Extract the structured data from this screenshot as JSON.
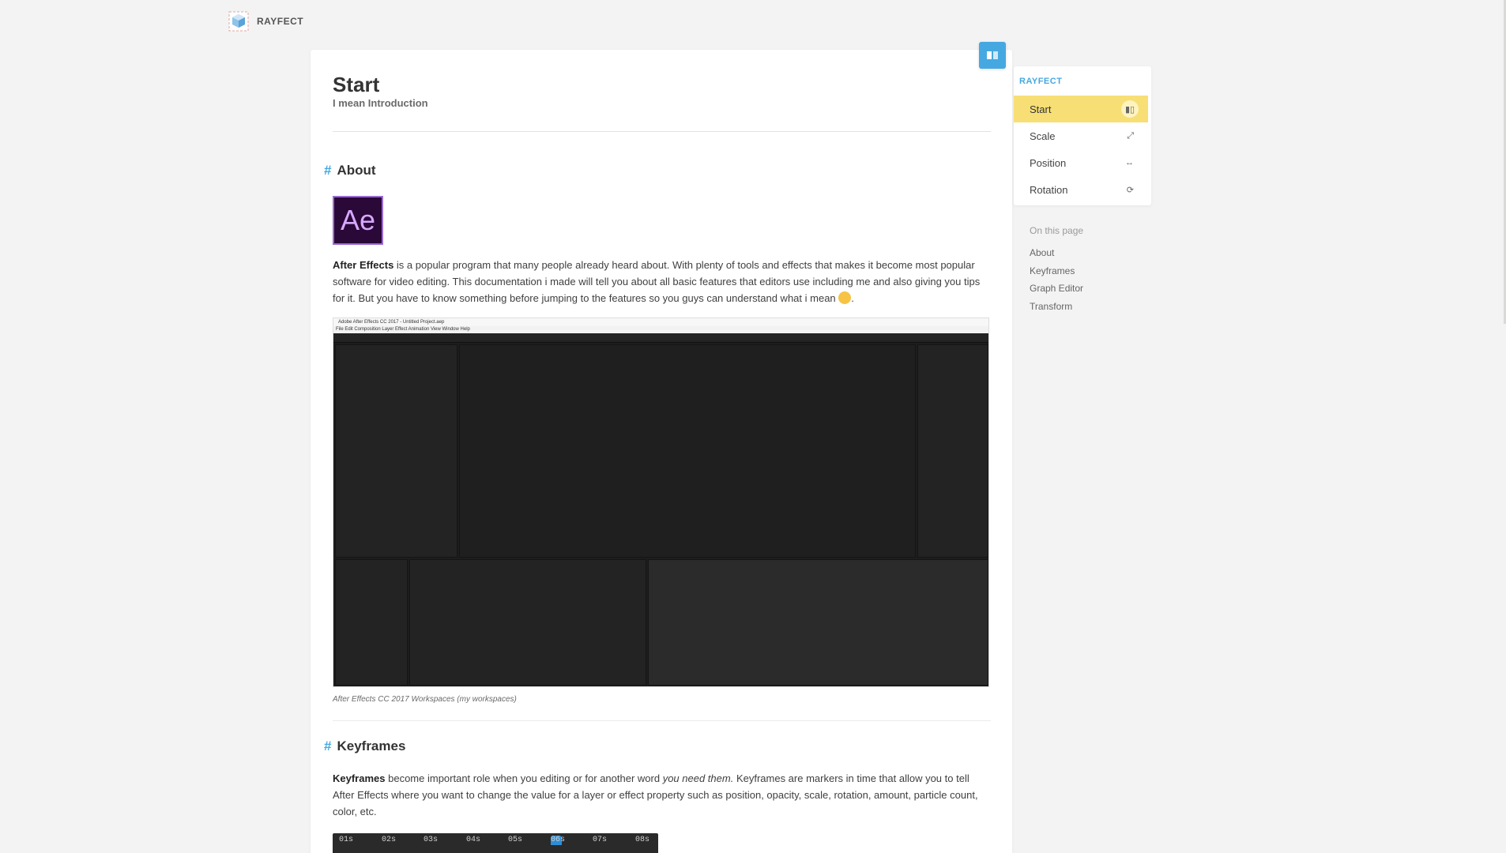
{
  "brand": {
    "name": "RAYFECT",
    "icon": "cube-logo-icon"
  },
  "header": {
    "toggle_icon": "book-icon"
  },
  "page": {
    "title": "Start",
    "subtitle": "I mean Introduction"
  },
  "about": {
    "heading": "About",
    "hash": "#",
    "logo_text": "Ae",
    "para_bold": "After Effects",
    "para_text_1": " is a popular program that many people already heard about. With plenty of tools and effects that makes it become most popular software for video editing. This documentation i made will tell you about all basic features that editors use including me and also giving you tips for it. But you have to know something before jumping to the features so you guys can understand what i mean ",
    "para_text_2": ".",
    "screenshot": {
      "window_title": "Adobe After Effects CC 2017 - Untitled Project.aep",
      "menu": "File   Edit   Composition   Layer   Effect   Animation   View   Window   Help"
    },
    "caption": "After Effects CC 2017 Workspaces (my workspaces)"
  },
  "keyframes": {
    "heading": "Keyframes",
    "hash": "#",
    "para_bold": "Keyframes",
    "para_text_1": " become important role when you editing or for another word ",
    "para_italic": "you need them.",
    "para_text_2": " Keyframes are markers in time that allow you to tell After Effects where you want to change the value for a layer or effect property such as position, opacity, scale, rotation, amount, particle count, color, etc.",
    "ruler_ticks": [
      "01s",
      "02s",
      "03s",
      "04s",
      "05s",
      "06s",
      "07s",
      "08s"
    ]
  },
  "nav": {
    "brand": "RAYFECT",
    "items": [
      {
        "label": "Start",
        "icon": "book-icon",
        "glyph": "▮▯",
        "active": true
      },
      {
        "label": "Scale",
        "icon": "resize-icon",
        "glyph": "⤢",
        "active": false
      },
      {
        "label": "Position",
        "icon": "arrows-horizontal-icon",
        "glyph": "↔",
        "active": false
      },
      {
        "label": "Rotation",
        "icon": "rotate-icon",
        "glyph": "⟳",
        "active": false
      }
    ]
  },
  "toc": {
    "heading": "On this page",
    "links": [
      "About",
      "Keyframes",
      "Graph Editor",
      "Transform"
    ]
  },
  "colors": {
    "accent": "#46a8e0",
    "active": "#f7df76",
    "ae_purple": "#2a0838"
  }
}
